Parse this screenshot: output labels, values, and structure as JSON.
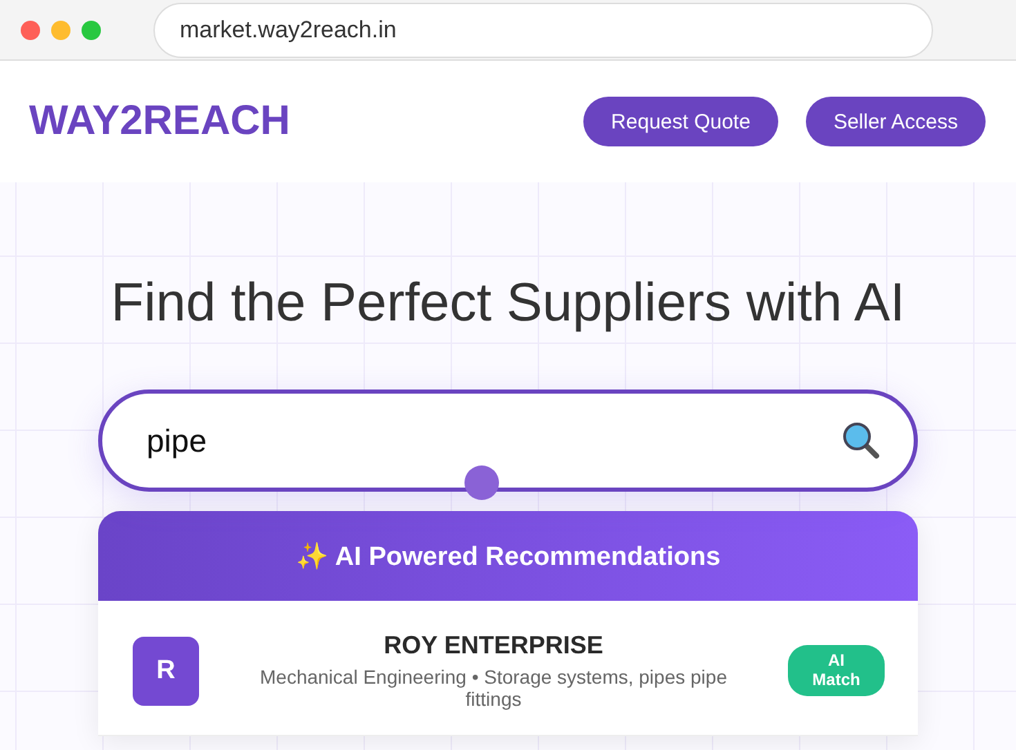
{
  "browser": {
    "url": "market.way2reach.in"
  },
  "header": {
    "logo": "WAY2REACH",
    "buttons": [
      "Request Quote",
      "Seller Access"
    ]
  },
  "hero": {
    "title": "Find the Perfect Suppliers with AI"
  },
  "search": {
    "value": "pipe"
  },
  "results": {
    "title": "✨ AI Powered Recommendations",
    "items": [
      {
        "initial": "R",
        "name": "ROY ENTERPRISE",
        "description": "Mechanical Engineering • Storage systems, pipes pipe fittings",
        "badge": "AI Match"
      }
    ]
  }
}
